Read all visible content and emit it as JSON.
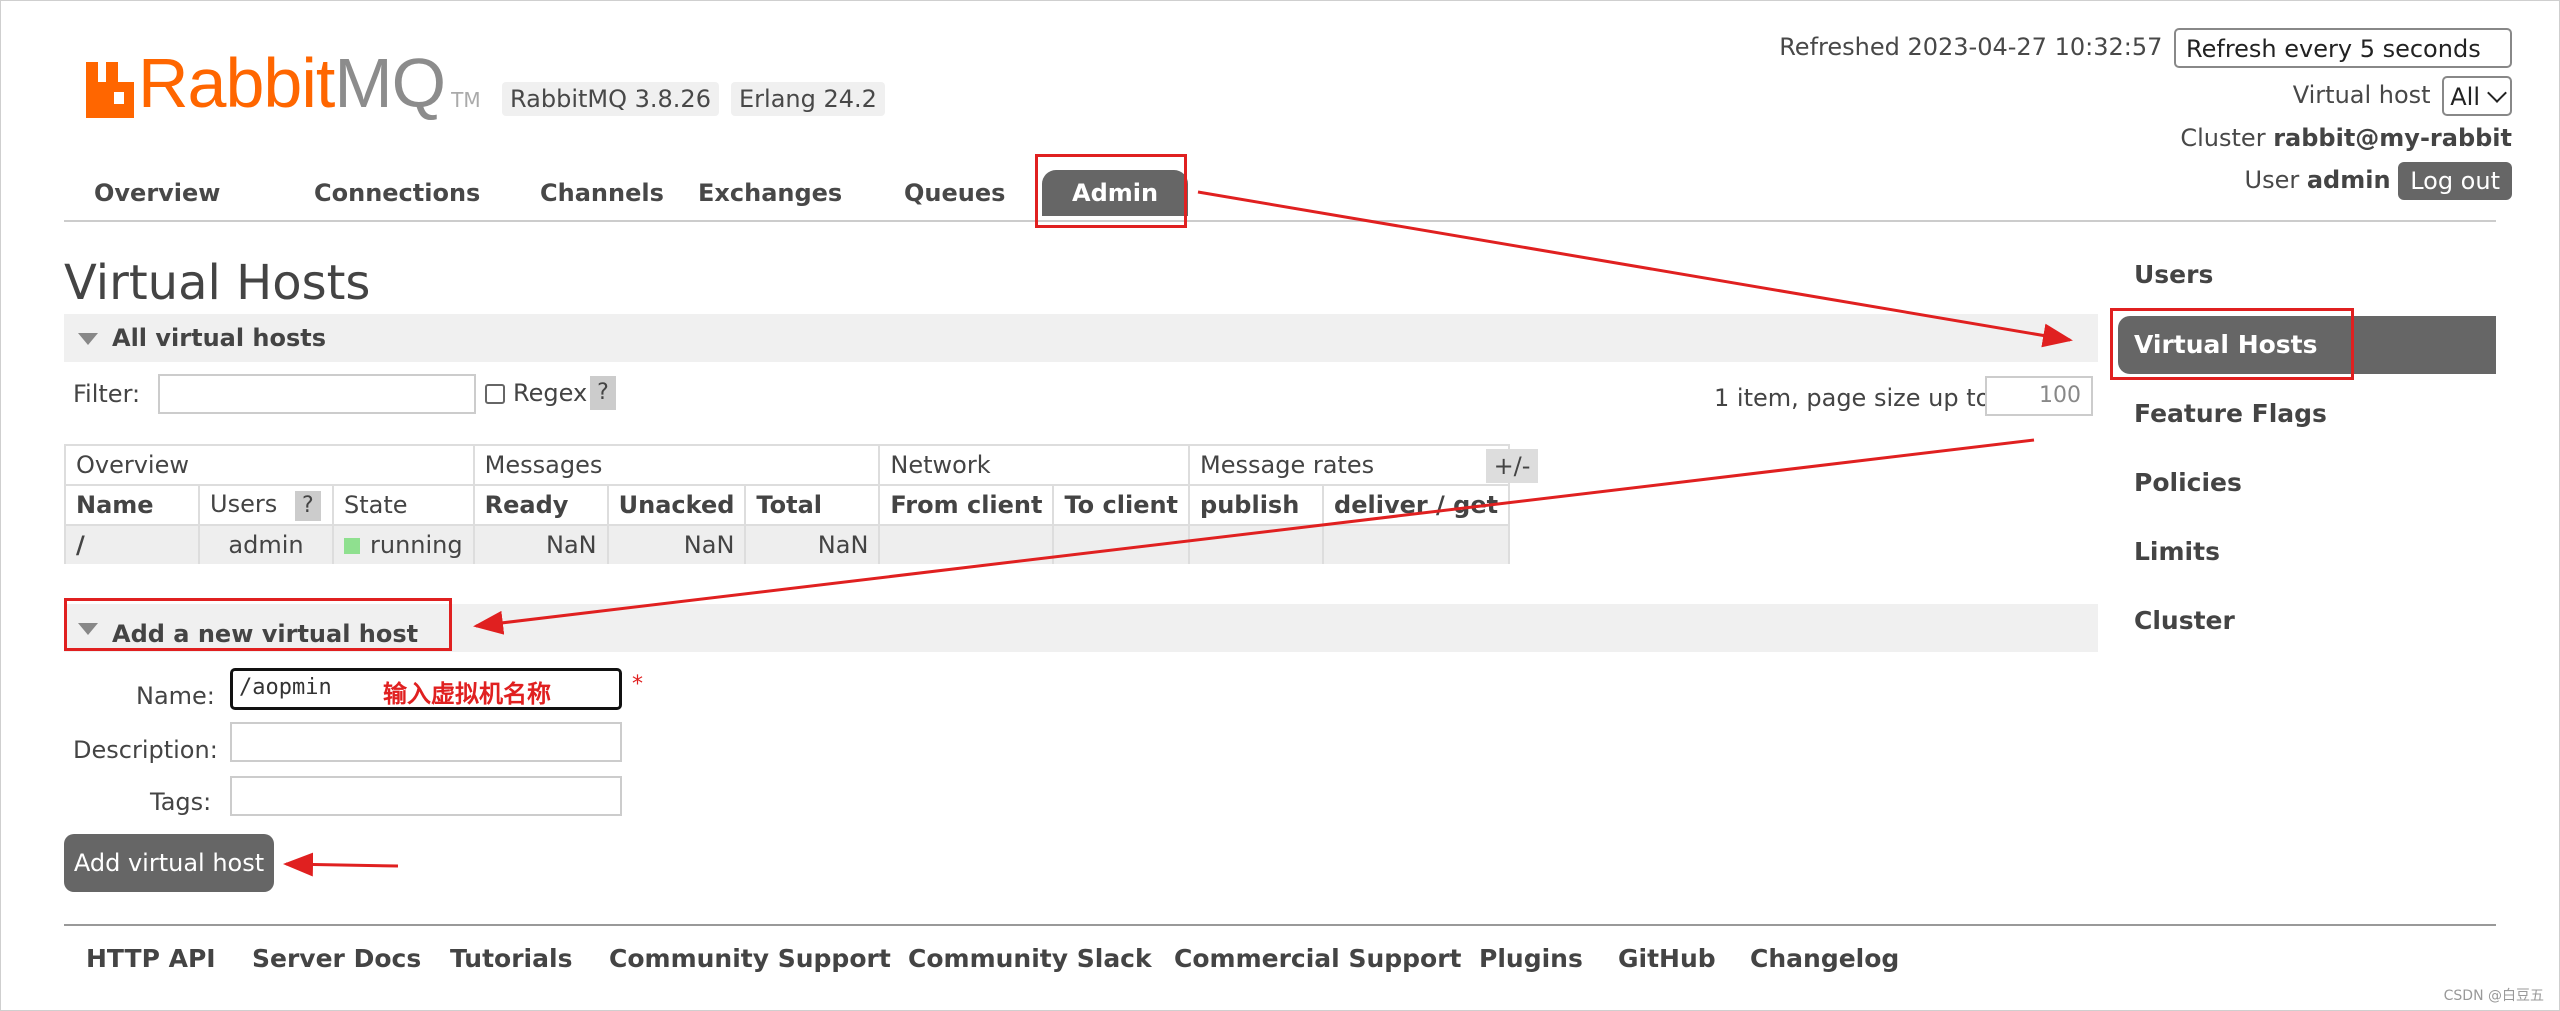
{
  "logo": {
    "rabbit": "Rabbit",
    "mq": "MQ",
    "tm": "TM"
  },
  "badges": {
    "version": "RabbitMQ 3.8.26",
    "erlang": "Erlang 24.2"
  },
  "header": {
    "refreshed_label": "Refreshed 2023-04-27 10:32:57",
    "refresh_select": "Refresh every 5 seconds",
    "vhost_label": "Virtual host",
    "vhost_select": "All",
    "cluster_label": "Cluster",
    "cluster_name": "rabbit@my-rabbit",
    "user_label": "User",
    "user_name": "admin",
    "logout": "Log out"
  },
  "nav": {
    "tabs": [
      "Overview",
      "Connections",
      "Channels",
      "Exchanges",
      "Queues",
      "Admin"
    ],
    "active": "Admin"
  },
  "page": {
    "title": "Virtual Hosts"
  },
  "all_vhosts": {
    "section_title": "All virtual hosts",
    "filter_label": "Filter:",
    "regex_label": "Regex",
    "help": "?",
    "pagination": "1 item, page size up to",
    "page_size": "100",
    "plus_minus": "+/-",
    "groups": [
      "Overview",
      "Messages",
      "Network",
      "Message rates"
    ],
    "columns": [
      "Name",
      "Users",
      "State",
      "Ready",
      "Unacked",
      "Total",
      "From client",
      "To client",
      "publish",
      "deliver / get"
    ],
    "rows": [
      {
        "name": "/",
        "users": "admin",
        "state": "running",
        "ready": "NaN",
        "unacked": "NaN",
        "total": "NaN",
        "from_client": "",
        "to_client": "",
        "publish": "",
        "deliver_get": ""
      }
    ]
  },
  "add_vhost": {
    "section_title": "Add a new virtual host",
    "name_label": "Name:",
    "name_value": "/aopmin",
    "required": "*",
    "description_label": "Description:",
    "tags_label": "Tags:",
    "submit": "Add virtual host",
    "annotation": "输入虚拟机名称"
  },
  "sidebar": {
    "items": [
      "Users",
      "Virtual Hosts",
      "Feature Flags",
      "Policies",
      "Limits",
      "Cluster"
    ],
    "active": "Virtual Hosts"
  },
  "footer": {
    "links": [
      "HTTP API",
      "Server Docs",
      "Tutorials",
      "Community Support",
      "Community Slack",
      "Commercial Support",
      "Plugins",
      "GitHub",
      "Changelog"
    ]
  },
  "watermark": "CSDN @白豆五",
  "colors": {
    "brand": "#ff6600",
    "active_tab": "#666666",
    "annotation": "#e02020",
    "state_running": "#8fe08f"
  }
}
